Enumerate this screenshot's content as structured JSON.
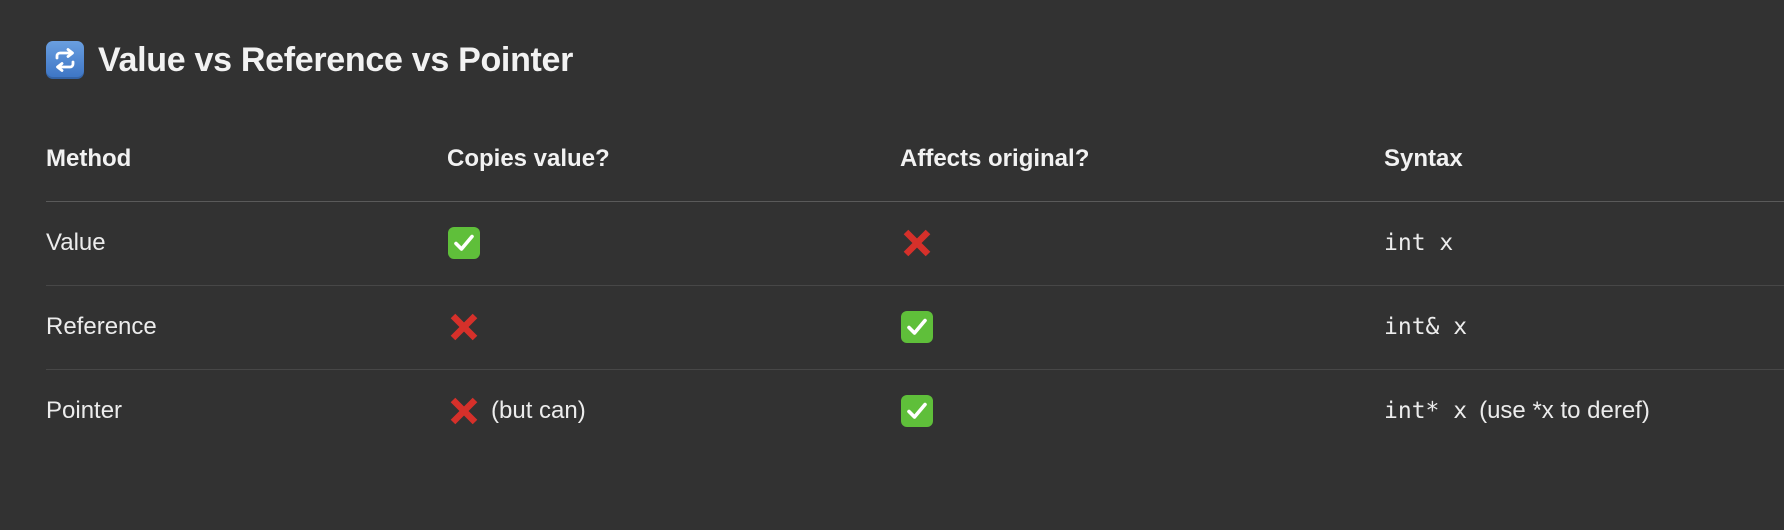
{
  "heading": {
    "icon": "repeat-arrows-icon",
    "title": "Value vs Reference vs Pointer"
  },
  "table": {
    "headers": [
      "Method",
      "Copies value?",
      "Affects original?",
      "Syntax"
    ],
    "rows": [
      {
        "method": "Value",
        "copies": {
          "icon": "check-mark-icon",
          "note": ""
        },
        "affects": {
          "icon": "cross-mark-icon"
        },
        "syntax": {
          "code": "int x",
          "note": ""
        }
      },
      {
        "method": "Reference",
        "copies": {
          "icon": "cross-mark-icon",
          "note": ""
        },
        "affects": {
          "icon": "check-mark-icon"
        },
        "syntax": {
          "code": "int& x",
          "note": ""
        }
      },
      {
        "method": "Pointer",
        "copies": {
          "icon": "cross-mark-icon",
          "note": "(but can)"
        },
        "affects": {
          "icon": "check-mark-icon"
        },
        "syntax": {
          "code": "int* x",
          "note": "(use *x to deref)"
        }
      }
    ]
  },
  "colors": {
    "background": "#323232",
    "text": "#ececec",
    "check_green": "#5fbf3a",
    "cross_red": "#d6302a",
    "icon_blue": "#4f88d6"
  }
}
